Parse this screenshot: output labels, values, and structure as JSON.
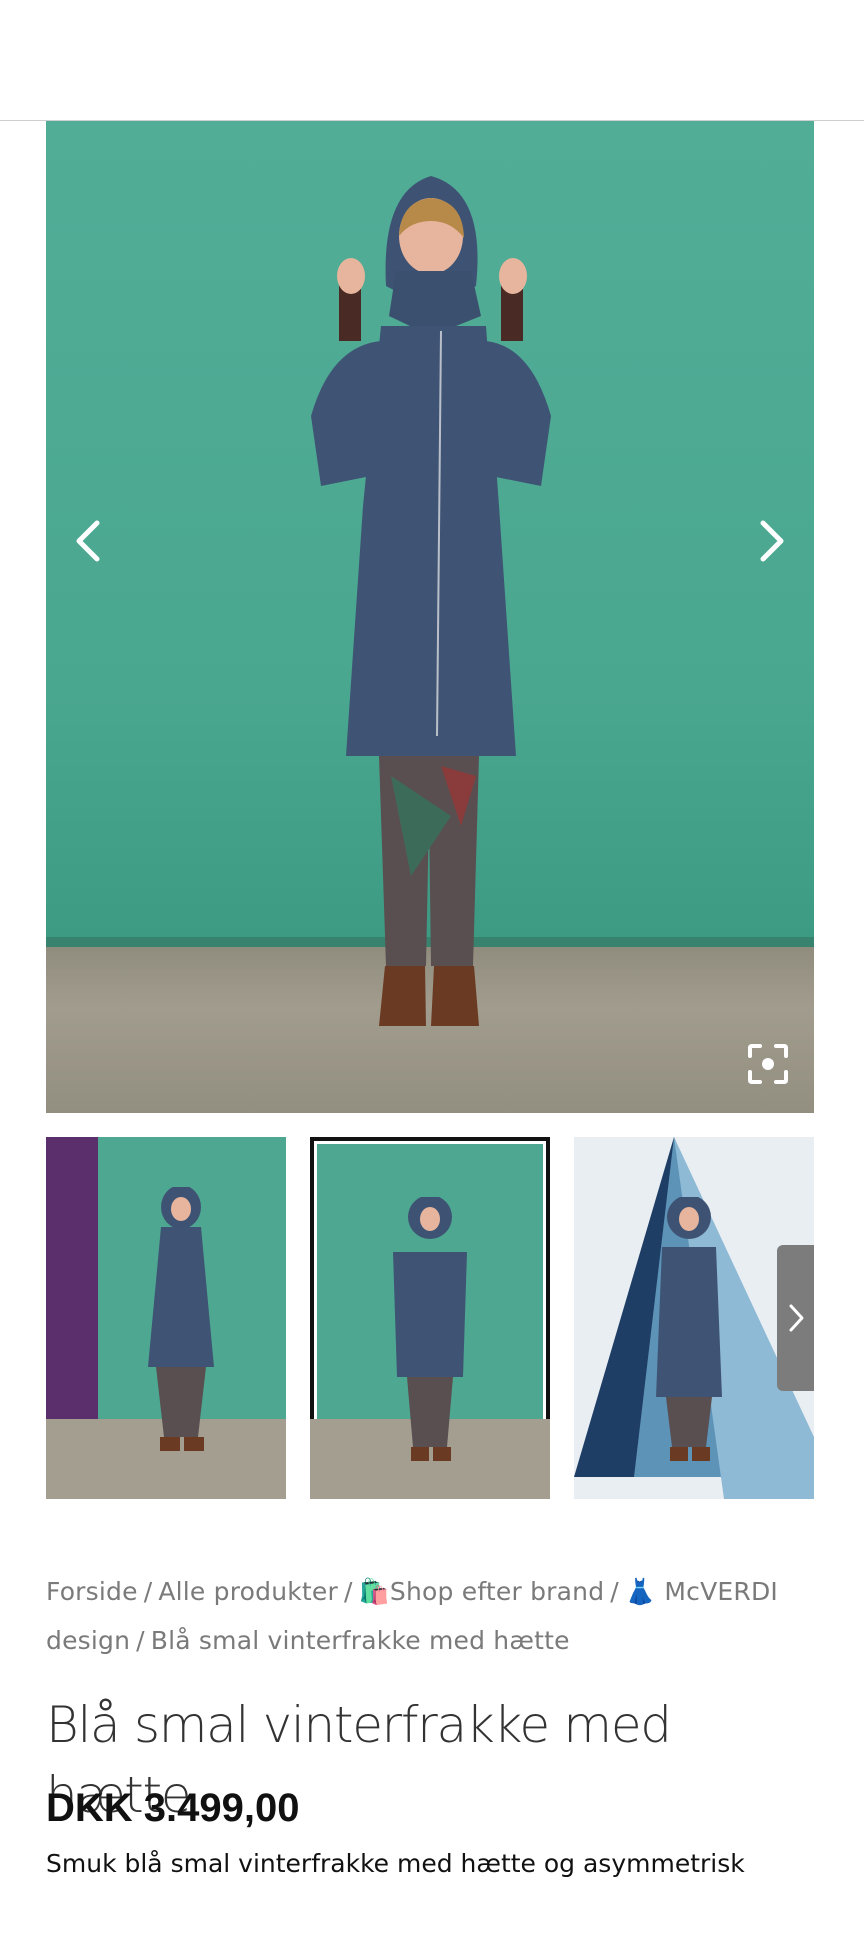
{
  "product": {
    "title": "Blå smal vinterfrakke med hætte",
    "price": "DKK 3.499,00",
    "description": "Smuk blå smal vinterfrakke med hætte og asymmetrisk"
  },
  "breadcrumb": [
    "Forside",
    "Alle produkter",
    "🛍️Shop efter brand",
    "👗 McVERDI design",
    "Blå smal vinterfrakke med hætte"
  ],
  "breadcrumb_separator": "/",
  "gallery": {
    "active_thumbnail_index": 1,
    "thumbnail_count": 3,
    "icons": {
      "prev": "chevron-left-icon",
      "next": "chevron-right-icon",
      "zoom": "zoom-icon",
      "thumbs_next": "chevron-right-icon"
    }
  },
  "colors": {
    "backdrop_green": "#4ea791",
    "coat_blue": "#3f5474",
    "breadcrumb_gray": "#7a7a7a",
    "thumb_nav_gray": "#7c7c7c"
  }
}
